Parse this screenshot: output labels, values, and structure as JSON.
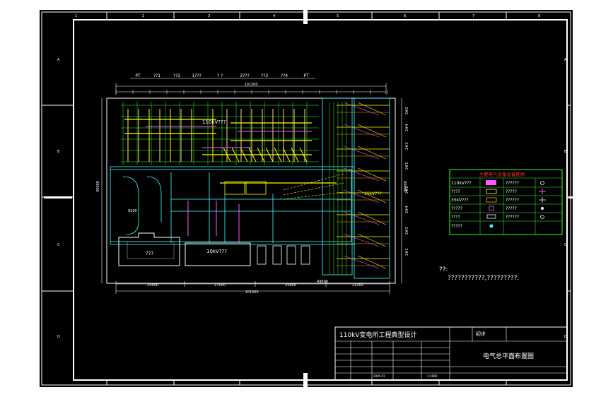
{
  "drawing": {
    "border_zone_numbers": [
      "1",
      "2",
      "3",
      "4",
      "5",
      "6",
      "7",
      "8"
    ],
    "border_zone_letters": [
      "A",
      "B",
      "C",
      "D"
    ],
    "bay_labels": [
      "PT",
      "??1",
      "??2",
      "1???",
      "? ?",
      "2???",
      "??3",
      "??4",
      "PT"
    ],
    "overall_dimension_top": "101300",
    "overall_dimension_bottom": "101300",
    "bottom_dimensions": [
      "25600",
      "27500",
      "25800",
      "23200"
    ],
    "left_dimension": "30000",
    "right_dimension": "30000",
    "small_dimension": "9200",
    "dimension_north": "49800",
    "label_110kv_top": "110kV???",
    "label_10kv_building": "10kV???",
    "label_35kv": "35kV???",
    "label_building_left": "???",
    "right_bay_labels": [
      "2#2",
      "2#4",
      "2#3",
      "2#1",
      "2#2",
      "2#4",
      "2#3",
      "2#1"
    ]
  },
  "legend": {
    "title": "主要电气设备设备图例",
    "color_title": "#ff3030",
    "rows": [
      {
        "name": "110kV???",
        "model": "??????"
      },
      {
        "name": "????",
        "model": "?????"
      },
      {
        "name": "35kV???",
        "model": "??????"
      },
      {
        "name": "?????",
        "model": "?????"
      },
      {
        "name": "????",
        "model": "??????"
      },
      {
        "name": "?????",
        "model": ""
      }
    ]
  },
  "notes": {
    "label": "??:",
    "line1": "???????????,?????????."
  },
  "title_block": {
    "project": "110kV变电所工程典型设计",
    "stage_label": "初步",
    "sheet_title": "电气总平面布置图",
    "date": "2005.01",
    "scale": "1:1000"
  }
}
